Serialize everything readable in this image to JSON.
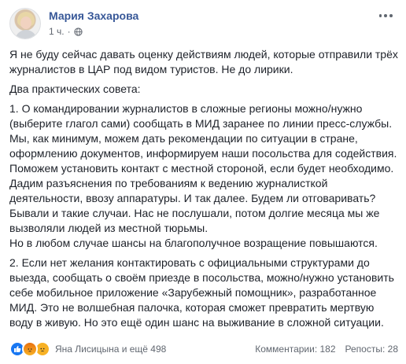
{
  "post": {
    "author": "Мария Захарова",
    "time": "1 ч.",
    "dot": "·",
    "audience_icon": "globe-icon",
    "menu_icon": "more-options-icon"
  },
  "content": {
    "p1": "Я не буду сейчас давать оценку действиям людей, которые отправили трёх журналистов в ЦАР под видом туристов. Не до лирики.",
    "p2": "Два практических совета:",
    "p3": "1. О командировании журналистов в сложные регионы можно/нужно (выберите глагол сами) сообщать в МИД заранее по линии пресс-службы. Мы, как минимум, можем дать рекомендации по ситуации в стране, оформлению документов, информируем наши посольства для содействия. Поможем установить контакт с местной стороной, если будет необходимо. Дадим разъяснения по требованиям к ведению журналисткой деятельности, ввозу аппаратуры. И так далее. Будем ли отговаривать? Бывали и такие случаи. Нас не послушали, потом долгие месяца мы же вызволяли людей из местной тюрьмы.\nНо в любом случае шансы на благополучное возращение повышаются.",
    "p4": "2. Если нет желания контактировать с официальными структурами до выезда, сообщать о своём приезде в посольства, можно/нужно установить себе мобильное приложение «Зарубежный помощник», разработанное МИД. Это не волшебная палочка, которая сможет превратить мертвую воду в живую. Но это ещё один шанс на выживание в сложной ситуации."
  },
  "footer": {
    "reaction_icons": [
      "like-icon",
      "angry-icon",
      "sad-icon"
    ],
    "reactors": "Яна Лисицына и ещё 498",
    "comments": "Комментарии: 182",
    "shares": "Репосты: 28"
  },
  "colors": {
    "author": "#385898",
    "meta": "#616770",
    "text": "#1d2129",
    "like": "#1877f2"
  }
}
